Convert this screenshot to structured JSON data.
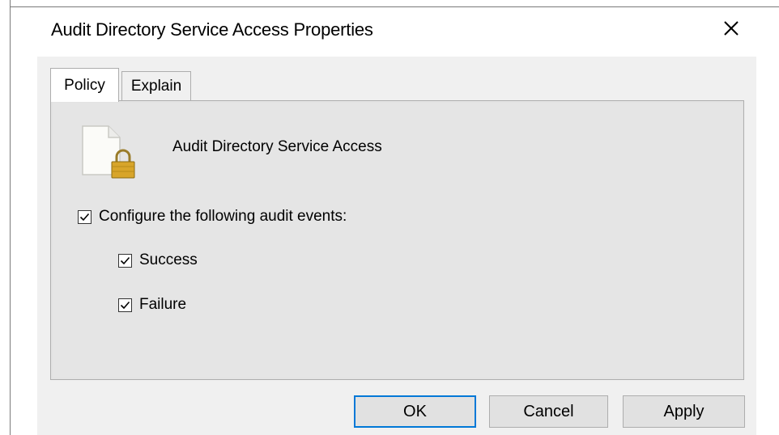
{
  "dialog": {
    "title": "Audit Directory Service Access Properties",
    "close_icon": "close-icon"
  },
  "tabs": [
    {
      "label": "Policy",
      "selected": true
    },
    {
      "label": "Explain",
      "selected": false
    }
  ],
  "policy": {
    "icon": "document-lock-icon",
    "name": "Audit Directory Service Access",
    "configure": {
      "label": "Configure the following audit events:",
      "checked": true
    },
    "success": {
      "label": "Success",
      "checked": true
    },
    "failure": {
      "label": "Failure",
      "checked": true
    }
  },
  "buttons": {
    "ok": "OK",
    "cancel": "Cancel",
    "apply": "Apply"
  },
  "colors": {
    "accent": "#0078d7",
    "dialog_bg": "#f0f0f0",
    "panel_bg": "#e5e5e5"
  }
}
